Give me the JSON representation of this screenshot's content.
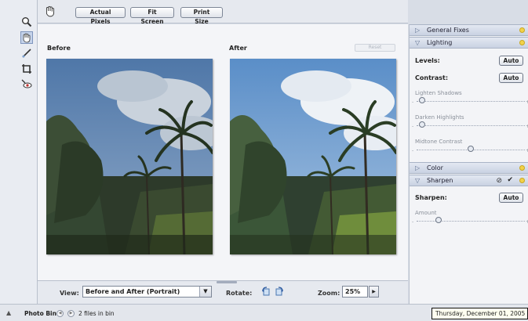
{
  "toolbar_top": {
    "buttons": [
      "Actual Pixels",
      "Fit Screen",
      "Print Size"
    ]
  },
  "tools": [
    "zoom-tool",
    "hand-tool",
    "straighten-tool",
    "crop-tool",
    "red-eye-tool"
  ],
  "canvas": {
    "before_label": "Before",
    "after_label": "After",
    "reset_label": "Reset"
  },
  "viewbar": {
    "view_label": "View:",
    "view_value": "Before and After (Portrait)",
    "rotate_label": "Rotate:",
    "zoom_label": "Zoom:",
    "zoom_value": "25%"
  },
  "palette": {
    "general_fixes": "General Fixes",
    "lighting": "Lighting",
    "levels_label": "Levels:",
    "contrast_label": "Contrast:",
    "auto_label": "Auto",
    "lighten_shadows": "Lighten Shadows",
    "darken_highlights": "Darken Highlights",
    "midtone_contrast": "Midtone Contrast",
    "color": "Color",
    "sharpen": "Sharpen",
    "sharpen_label": "Sharpen:",
    "amount_label": "Amount",
    "slider_min": "-",
    "slider_max": "+",
    "sliders": {
      "lighten_shadows": 0.05,
      "darken_highlights": 0.05,
      "midtone_contrast": 0.5,
      "amount": 0.2
    }
  },
  "statusbar": {
    "photo_bin": "Photo Bin",
    "file_count": "2 files in bin",
    "date": "Thursday, December 01, 2005"
  }
}
